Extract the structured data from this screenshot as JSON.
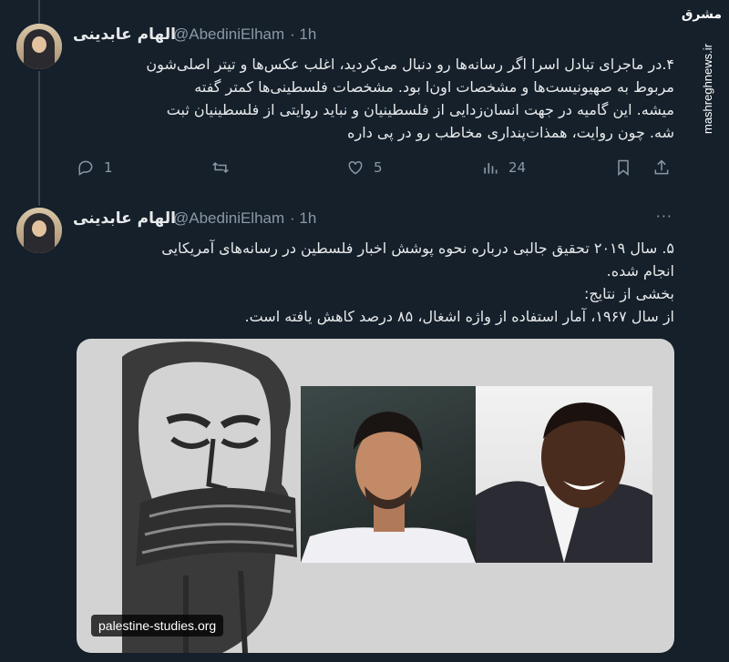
{
  "watermark": {
    "logo": "مشرق",
    "url": "mashreghnews.ir"
  },
  "tweets": [
    {
      "author_name": "الهام عابدینی",
      "handle": "@AbediniElham",
      "time": "· 1h",
      "text": "۴.در ماجرای تبادل اسرا اگر رسانه‌ها رو دنبال می‌کردید، اغلب عکس‌ها و تیتر اصلی‌شون\nمربوط به صهیونیست‌ها و مشخصات اون‌ا بود. مشخصات فلسطینی‌ها کمتر گفته\nمیشه. این گامیه در جهت انسان‌زدایی از فلسطینیان و نباید روایتی از فلسطینیان ثبت\nشه. چون روایت، همذات‌پنداری مخاطب رو در پی داره",
      "replies": "1",
      "likes": "5",
      "views": "24"
    },
    {
      "author_name": "الهام عابدینی",
      "handle": "@AbediniElham",
      "time": "· 1h",
      "more": "···",
      "text": "۵. سال ۲۰۱۹ تحقیق جالبی درباره نحوه پوشش اخبار فلسطین در رسانه‌های آمریکایی\nانجام شده.\nبخشی از نتایج:\nاز سال ۱۹۶۷، آمار استفاده از واژه اشغال، ۸۵ درصد کاهش یافته است.",
      "media_link": "palestine-studies.org"
    }
  ]
}
